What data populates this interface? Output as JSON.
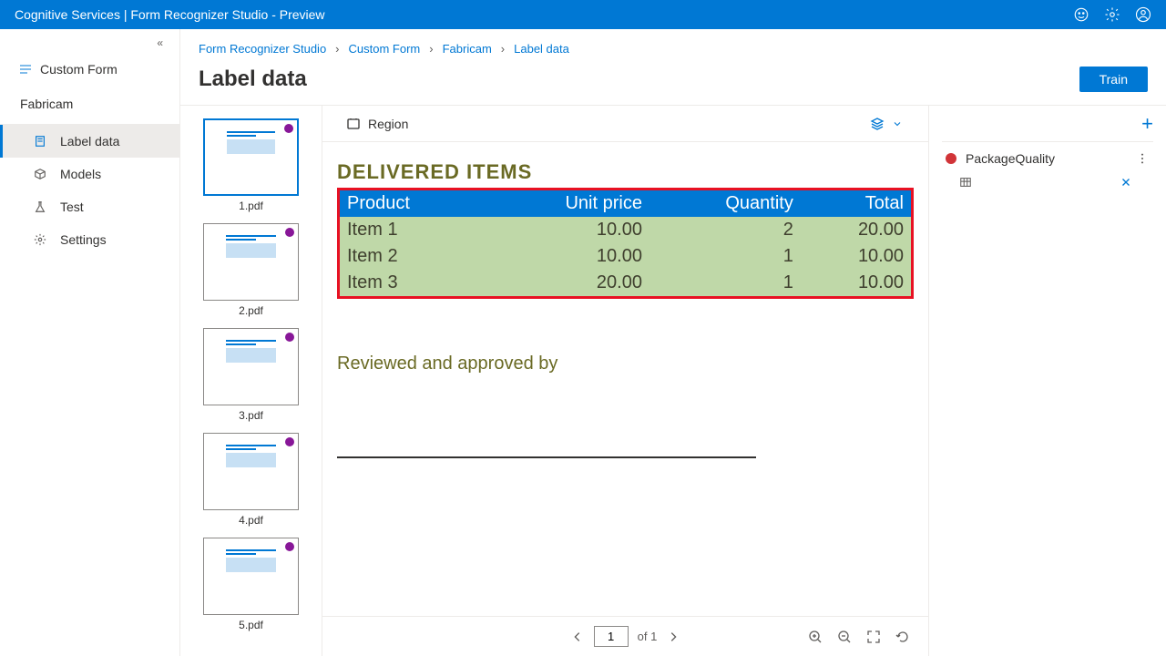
{
  "app_title": "Cognitive Services | Form Recognizer Studio - Preview",
  "sidebar": {
    "section": "Custom Form",
    "project": "Fabricam",
    "items": [
      {
        "label": "Label data",
        "icon": "document"
      },
      {
        "label": "Models",
        "icon": "cube"
      },
      {
        "label": "Test",
        "icon": "flask"
      },
      {
        "label": "Settings",
        "icon": "gear"
      }
    ]
  },
  "breadcrumb": [
    "Form Recognizer Studio",
    "Custom Form",
    "Fabricam",
    "Label data"
  ],
  "page_title": "Label data",
  "train_label": "Train",
  "thumbs": [
    "1.pdf",
    "2.pdf",
    "3.pdf",
    "4.pdf",
    "5.pdf"
  ],
  "canvas_toolbar": {
    "region": "Region"
  },
  "doc": {
    "heading": "DELIVERED ITEMS",
    "columns": [
      "Product",
      "Unit price",
      "Quantity",
      "Total"
    ],
    "rows": [
      {
        "product": "Item 1",
        "unit": "10.00",
        "qty": "2",
        "total": "20.00"
      },
      {
        "product": "Item 2",
        "unit": "10.00",
        "qty": "1",
        "total": "10.00"
      },
      {
        "product": "Item 3",
        "unit": "20.00",
        "qty": "1",
        "total": "10.00"
      }
    ],
    "reviewed": "Reviewed and approved by"
  },
  "pager": {
    "current": "1",
    "total": "of 1"
  },
  "fields": {
    "item": {
      "name": "PackageQuality"
    }
  }
}
